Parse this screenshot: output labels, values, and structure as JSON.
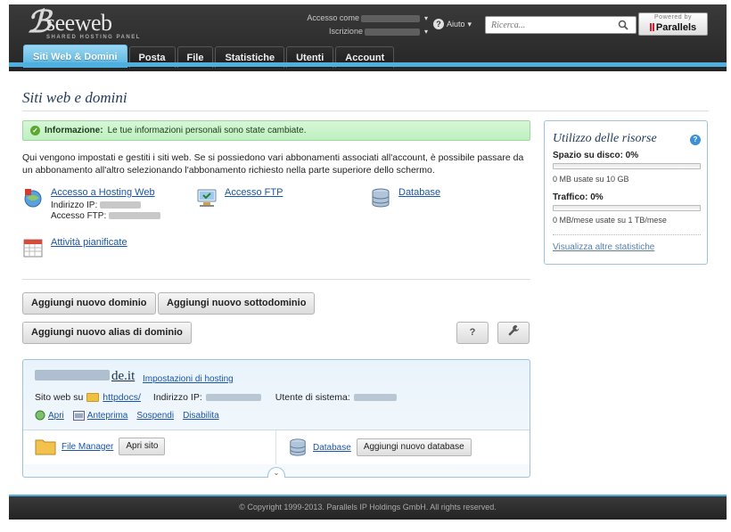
{
  "header": {
    "brand": "seeweb",
    "brand_tagline": "SHARED HOSTING PANEL",
    "logged_as_label": "Accesso come",
    "subscription_label": "Iscrizione",
    "help_label": "Aiuto",
    "search_placeholder": "Ricerca...",
    "powered_by": "Powered by",
    "powered_brand": "Parallels"
  },
  "tabs": [
    {
      "label": "Siti Web & Domini",
      "active": true
    },
    {
      "label": "Posta"
    },
    {
      "label": "File"
    },
    {
      "label": "Statistiche"
    },
    {
      "label": "Utenti"
    },
    {
      "label": "Account"
    }
  ],
  "main": {
    "title": "Siti web e domini",
    "info_label": "Informazione:",
    "info_text": "Le tue informazioni personali sono state cambiate.",
    "intro": "Qui vengono impostati e gestiti i siti web. Se si possiedono vari abbonamenti associati all'account, è possibile passare da un abbonamento all'altro selezionando l'abbonamento richiesto nella parte superiore dello schermo.",
    "tools": {
      "hosting_access": "Accesso a Hosting Web",
      "ip_label": "Indirizzo IP:",
      "ftp_access_label": "Accesso FTP:",
      "ftp_access": "Accesso FTP",
      "database": "Database",
      "scheduled_tasks": "Attività pianificate"
    },
    "buttons": {
      "add_domain": "Aggiungi nuovo dominio",
      "add_subdomain": "Aggiungi nuovo sottodominio",
      "add_alias": "Aggiungi nuovo alias di dominio",
      "help": "?"
    },
    "domain": {
      "tld": "de.it",
      "hosting_settings": "Impostazioni di hosting",
      "site_on": "Sito web su",
      "docroot": "httpdocs/",
      "ip_label": "Indirizzo IP:",
      "sysuser_label": "Utente di sistema:",
      "open": "Apri",
      "preview": "Anteprima",
      "suspend": "Sospendi",
      "disable": "Disabilita",
      "file_manager": "File Manager",
      "open_site": "Apri sito",
      "database": "Database",
      "add_database": "Aggiungi nuovo database"
    }
  },
  "resources": {
    "title": "Utilizzo delle risorse",
    "disk_label": "Spazio su disco: 0%",
    "disk_usage": "0 MB usate su 10 GB",
    "disk_fraction": 0,
    "traffic_label": "Traffico: 0%",
    "traffic_usage": "0 MB/mese usate su 1 TB/mese",
    "traffic_fraction": 0,
    "more_stats": "Visualizza altre statistiche"
  },
  "footer": {
    "copyright": "© Copyright 1999-2013. Parallels IP Holdings GmbH. All rights reserved."
  },
  "colors": {
    "accent": "#4fb0e0",
    "header_bg": "#2b2b2b",
    "link": "#1b55a7",
    "success_bg": "#c8f3c8"
  },
  "icons": [
    "hosting-access-icon",
    "ftp-icon",
    "database-icon",
    "calendar-icon",
    "wrench-icon",
    "search-icon",
    "folder-icon",
    "info-icon"
  ]
}
